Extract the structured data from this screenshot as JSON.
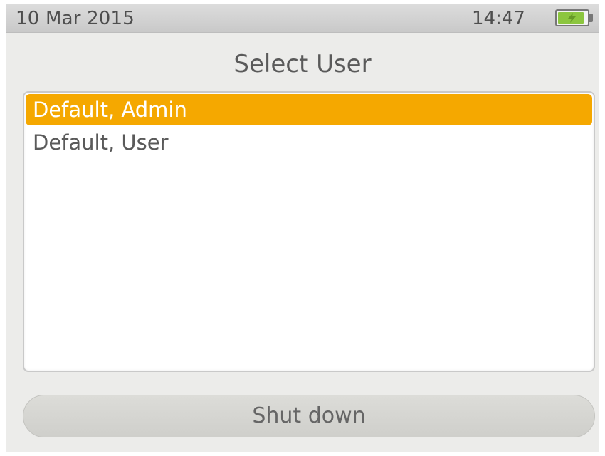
{
  "status_bar": {
    "date": "10 Mar 2015",
    "time": "14:47",
    "battery_level": 0.9,
    "battery_icon": "battery-charging-icon"
  },
  "title": "Select User",
  "users": [
    {
      "label": "Default, Admin",
      "selected": true
    },
    {
      "label": "Default, User",
      "selected": false
    }
  ],
  "shutdown_label": "Shut down",
  "colors": {
    "selection": "#f5a800",
    "battery_fill": "#8cc63f"
  }
}
